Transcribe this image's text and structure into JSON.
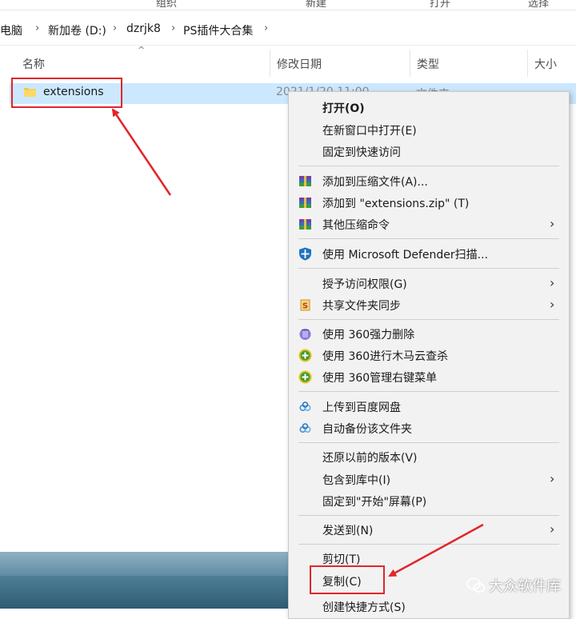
{
  "ribbon": {
    "groups": [
      "组织",
      "新建",
      "打开",
      "选择"
    ]
  },
  "address": {
    "crumbs": [
      "此电脑",
      "新加卷 (D:)",
      "dzrjk8",
      "PS插件大合集"
    ],
    "separator": "›"
  },
  "columns": {
    "name": "名称",
    "modified": "修改日期",
    "type": "类型",
    "size": "大小",
    "sort_caret": "^"
  },
  "file": {
    "name": "extensions",
    "modified": "2021/1/20 11:00",
    "type": "文件夹"
  },
  "context_menu": {
    "items": [
      {
        "label": "打开(O)",
        "bold": true
      },
      {
        "label": "在新窗口中打开(E)"
      },
      {
        "label": "固定到快速访问"
      },
      {
        "label": "添加到压缩文件(A)...",
        "icon": "archive-icon"
      },
      {
        "label": "添加到 \"extensions.zip\" (T)",
        "icon": "archive-icon"
      },
      {
        "label": "其他压缩命令",
        "icon": "archive-icon",
        "submenu": true
      },
      {
        "label": "使用 Microsoft Defender扫描...",
        "icon": "defender-shield-icon"
      },
      {
        "label": "授予访问权限(G)",
        "submenu": true
      },
      {
        "label": "共享文件夹同步",
        "icon": "sync-s-icon",
        "submenu": true
      },
      {
        "label": "使用 360强力删除",
        "icon": "360-delete-icon"
      },
      {
        "label": "使用 360进行木马云查杀",
        "icon": "360-plus-icon"
      },
      {
        "label": "使用 360管理右键菜单",
        "icon": "360-plus-icon"
      },
      {
        "label": "上传到百度网盘",
        "icon": "baidu-cloud-icon"
      },
      {
        "label": "自动备份该文件夹",
        "icon": "baidu-cloud-icon"
      },
      {
        "label": "还原以前的版本(V)"
      },
      {
        "label": "包含到库中(I)",
        "submenu": true
      },
      {
        "label": "固定到\"开始\"屏幕(P)"
      },
      {
        "label": "发送到(N)",
        "submenu": true
      },
      {
        "label": "剪切(T)"
      },
      {
        "label": "复制(C)"
      },
      {
        "label": "创建快捷方式(S)"
      }
    ],
    "submenu_arrow": "›"
  },
  "watermark": {
    "text": "大众软件库"
  },
  "colors": {
    "selection": "#cce8ff",
    "highlight_box": "#e0262b",
    "menu_bg": "#f2f2f2"
  }
}
